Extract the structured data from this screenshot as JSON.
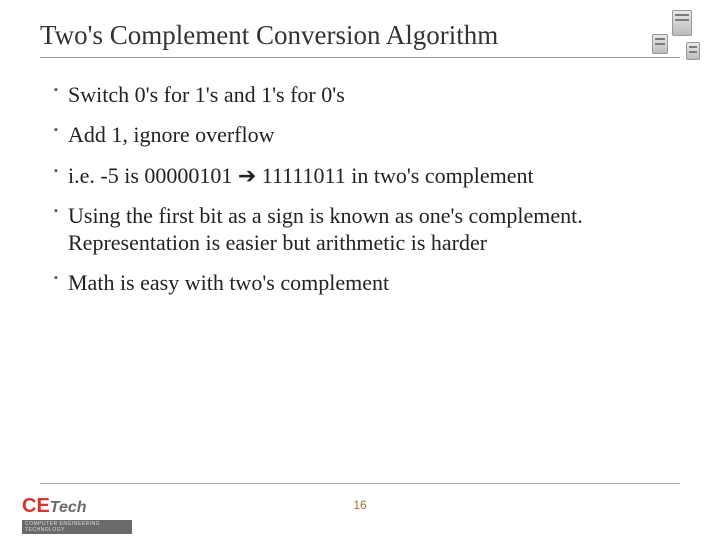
{
  "title": "Two's Complement Conversion Algorithm",
  "bullets": [
    "Switch 0's for 1's and 1's for 0's",
    "Add 1, ignore overflow",
    "i.e. -5 is 00000101 ➔ 11111011 in two's complement",
    "Using the first bit as a sign is known as one's complement. Representation is easier but arithmetic is harder",
    "Math is easy with two's complement"
  ],
  "page_number": "16",
  "logo": {
    "prefix": "CE",
    "suffix": "Tech",
    "subtitle": "COMPUTER ENGINEERING TECHNOLOGY"
  }
}
